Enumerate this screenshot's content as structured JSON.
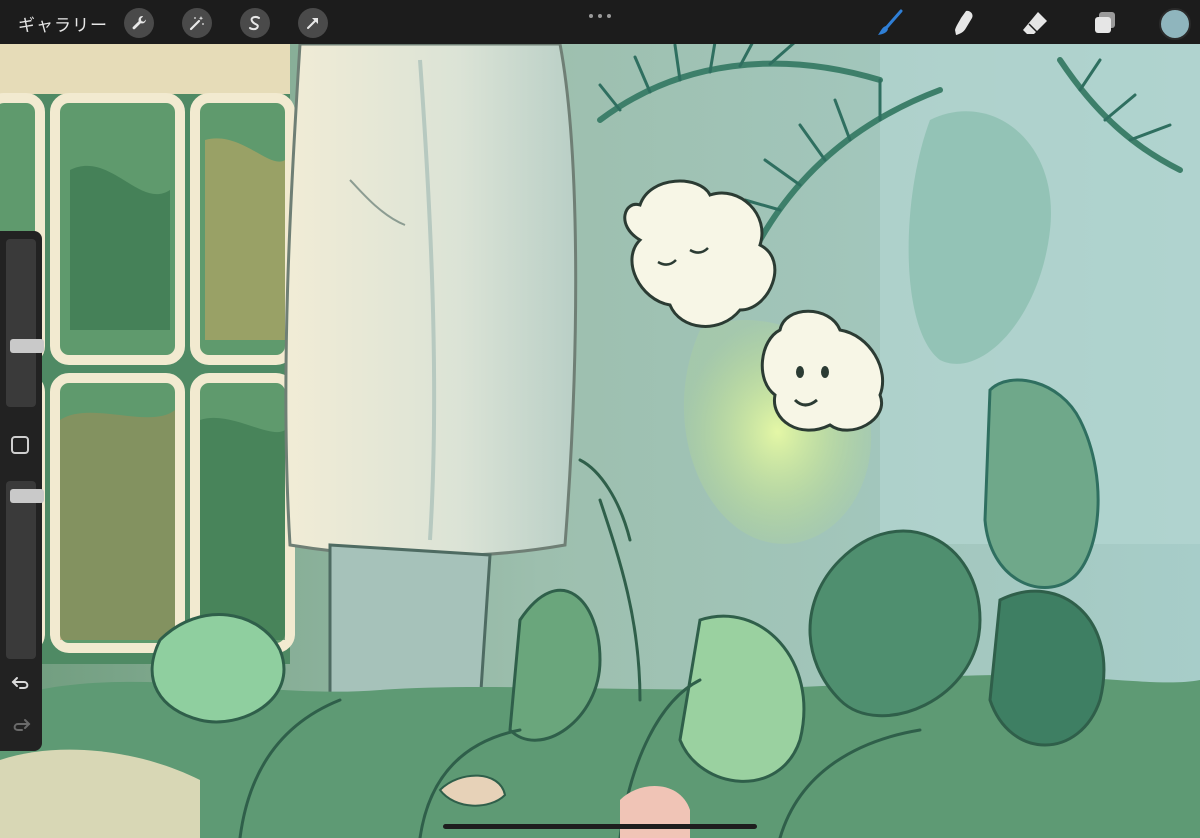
{
  "topbar": {
    "gallery_label": "ギャラリー",
    "left_tools": [
      {
        "name": "actions",
        "icon": "wrench-icon"
      },
      {
        "name": "adjustments",
        "icon": "magic-wand-icon"
      },
      {
        "name": "selection",
        "icon": "selection-s-icon"
      },
      {
        "name": "transform",
        "icon": "arrow-icon"
      }
    ],
    "more_icon": "more-dots-icon",
    "right_tools": [
      {
        "name": "brush",
        "icon": "brush-icon",
        "active": true
      },
      {
        "name": "smudge",
        "icon": "smudge-finger-icon"
      },
      {
        "name": "eraser",
        "icon": "eraser-icon"
      },
      {
        "name": "layers",
        "icon": "layers-icon"
      }
    ],
    "current_color": "#8fb5bd",
    "active_tool_color": "#2f7fd6"
  },
  "sidebar": {
    "brush_size_level": 0.35,
    "opacity_level": 0.95,
    "icons": [
      "square-modify-icon",
      "undo-icon",
      "redo-icon"
    ]
  }
}
